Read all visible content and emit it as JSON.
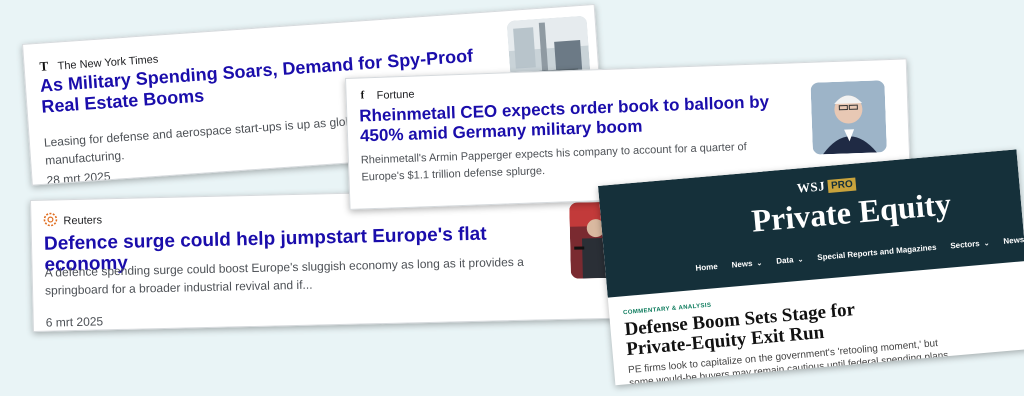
{
  "cards": {
    "nyt": {
      "source": "The New York Times",
      "headline": "As Military Spending Soars, Demand for Spy-Proof Real Estate Booms",
      "snippet": "Leasing for defense and aerospace start-ups is up as global investments in manufacturing.",
      "date": "28 mrt 2025",
      "icon": "nyt-t-logo-icon"
    },
    "fortune": {
      "source": "Fortune",
      "headline": "Rheinmetall CEO expects order book to balloon by 450% amid Germany military boom",
      "snippet": "Rheinmetall's Armin Papperger expects his company to account for a quarter of Europe's $1.1 trillion defense splurge.",
      "icon": "fortune-f-logo-icon"
    },
    "reuters": {
      "source": "Reuters",
      "headline": "Defence surge could help jumpstart Europe's flat economy",
      "snippet": "A defence spending surge could boost Europe's sluggish economy as long as it provides a springboard for a broader industrial revival and if...",
      "date": "6 mrt 2025",
      "icon": "reuters-logo-icon"
    },
    "wsj": {
      "logo": "WSJ",
      "logo_badge": "PRO",
      "section_title": "Private Equity",
      "nav": [
        "Home",
        "News",
        "Data",
        "Special Reports and Magazines",
        "Sectors",
        "Newsletters"
      ],
      "kicker": "COMMENTARY & ANALYSIS",
      "headline": "Defense Boom Sets Stage for Private-Equity Exit Run",
      "dek": "PE firms look to capitalize on the government's 'retooling moment,' but some would-be buyers may remain cautious until federal spending plans under Donald Trump become clear"
    }
  },
  "colors": {
    "background": "#e9f4f6",
    "link": "#1a0dab",
    "wsj_banner": "#15303a",
    "wsj_pro": "#c8a33c",
    "wsj_kicker": "#0a7a5b"
  }
}
